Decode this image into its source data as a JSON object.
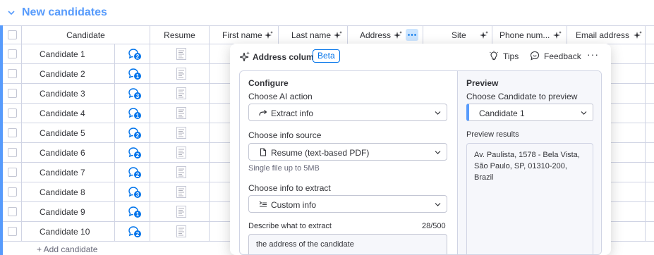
{
  "group": {
    "title": "New candidates"
  },
  "table": {
    "headers": {
      "candidate": "Candidate",
      "resume": "Resume",
      "first_name": "First name",
      "last_name": "Last name",
      "address": "Address",
      "site": "Site",
      "phone": "Phone num...",
      "email": "Email address"
    },
    "rows": [
      {
        "name": "Candidate 1",
        "updates": "2"
      },
      {
        "name": "Candidate 2",
        "updates": "1"
      },
      {
        "name": "Candidate 3",
        "updates": "3"
      },
      {
        "name": "Candidate 4",
        "updates": "1"
      },
      {
        "name": "Candidate 5",
        "updates": "2"
      },
      {
        "name": "Candidate 6",
        "updates": "2"
      },
      {
        "name": "Candidate 7",
        "updates": "2"
      },
      {
        "name": "Candidate 8",
        "updates": "3"
      },
      {
        "name": "Candidate 9",
        "updates": "1"
      },
      {
        "name": "Candidate 10",
        "updates": "2"
      }
    ],
    "add_label": "+ Add candidate"
  },
  "panel": {
    "title": "Address column",
    "badge": "Beta",
    "tips": "Tips",
    "feedback": "Feedback",
    "more": "···",
    "config": {
      "section_title": "Configure",
      "ai_action_label": "Choose AI action",
      "ai_action_value": "Extract info",
      "source_label": "Choose info source",
      "source_value": "Resume (text-based PDF)",
      "source_hint": "Single file up to 5MB",
      "extract_label": "Choose info to extract",
      "extract_value": "Custom info",
      "describe_label": "Describe what to extract",
      "describe_count": "28/500",
      "describe_value": "the address of the candidate"
    },
    "preview": {
      "section_title": "Preview",
      "choose_label": "Choose Candidate to preview",
      "choose_value": "Candidate 1",
      "results_label": "Preview results",
      "results_value": "Av. Paulista, 1578 - Bela Vista, São Paulo, SP, 01310-200, Brazil"
    }
  },
  "colors": {
    "brand": "#579bfc",
    "primary": "#0073ea",
    "text": "#323338",
    "border": "#d0d4e4",
    "surface": "#f6f7fb"
  },
  "icons": [
    "chevron-down-icon",
    "ai-sparkle-icon",
    "updates-icon",
    "document-icon",
    "lightbulb-icon",
    "feedback-icon",
    "more-icon",
    "arrow-right-icon",
    "file-icon",
    "list-icon"
  ]
}
